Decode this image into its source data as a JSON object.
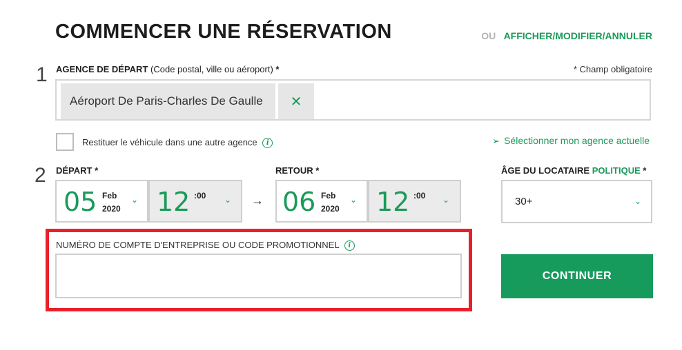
{
  "header": {
    "title": "COMMENCER UNE RÉSERVATION",
    "or_label": "OU",
    "manage_link": "AFFICHER/MODIFIER/ANNULER"
  },
  "step1": {
    "number": "1",
    "label_bold": "AGENCE DE DÉPART",
    "label_hint": "(Code postal, ville ou aéroport)",
    "label_required": "*",
    "required_note": "* Champ obligatoire",
    "selected_agency": "Aéroport De Paris-Charles De Gaulle",
    "clear_glyph": "✕",
    "return_other_label": "Restituer le véhicule dans une autre agence",
    "info_glyph": "i",
    "locate_glyph": "➢",
    "locate_label": "Sélectionner mon agence actuelle"
  },
  "step2": {
    "number": "2",
    "departure": {
      "label": "DÉPART *",
      "day": "05",
      "month": "Feb",
      "year": "2020",
      "hour": "12",
      "minutes": ":00"
    },
    "arrow_glyph": "→",
    "return": {
      "label": "RETOUR *",
      "day": "06",
      "month": "Feb",
      "year": "2020",
      "hour": "12",
      "minutes": ":00"
    },
    "age": {
      "label_bold": "ÂGE DU LOCATAIRE",
      "policy_link": "POLITIQUE",
      "label_required": "*",
      "value": "30+"
    },
    "chevron_glyph": "⌄"
  },
  "promo": {
    "label": "NUMÉRO DE COMPTE D'ENTREPRISE OU CODE PROMOTIONNEL",
    "value": "",
    "placeholder": ""
  },
  "continue_button": "CONTINUER",
  "colors": {
    "accent": "#1a9a5a",
    "button": "#179b5c",
    "highlight": "#e8202a"
  }
}
